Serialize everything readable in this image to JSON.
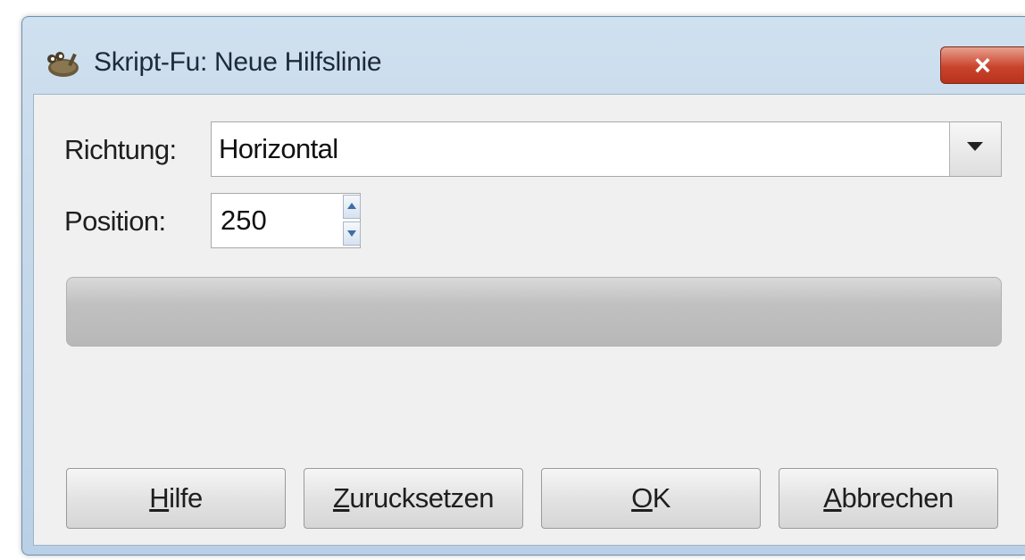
{
  "window": {
    "title": "Skript-Fu: Neue Hilfslinie",
    "close_label": "×",
    "app_icon": "gimp-wilber-icon"
  },
  "form": {
    "direction": {
      "label": "Richtung:",
      "value": "Horizontal",
      "dropdown_icon": "chevron-down-icon"
    },
    "position": {
      "label": "Position:",
      "value": "250",
      "spin_icons": [
        "spin-up-icon",
        "spin-down-icon"
      ]
    },
    "progress": {
      "fraction": 0
    }
  },
  "buttons": {
    "help": {
      "mnemonic": "H",
      "rest": "ilfe"
    },
    "reset": {
      "mnemonic": "Z",
      "rest": "urucksetzen"
    },
    "ok": {
      "mnemonic": "O",
      "rest": "K"
    },
    "cancel": {
      "mnemonic": "A",
      "rest": "bbrechen"
    }
  },
  "colors": {
    "close_button": "#c9442d",
    "titlebar": "#cfe0ef",
    "client_bg": "#f0f0f0"
  }
}
